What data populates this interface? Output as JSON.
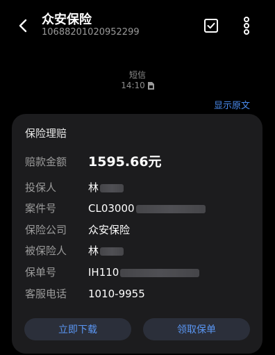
{
  "header": {
    "title": "众安保险",
    "number": "10688201020952299"
  },
  "message": {
    "type": "短信",
    "time": "14:10",
    "show_original": "显示原文"
  },
  "card": {
    "title": "保险理赔",
    "rows": [
      {
        "label": "赔款金额",
        "value": "1595.66元"
      },
      {
        "label": "投保人",
        "value": "林"
      },
      {
        "label": "案件号",
        "value": "CL03000"
      },
      {
        "label": "保险公司",
        "value": "众安保险"
      },
      {
        "label": "被保险人",
        "value": "林"
      },
      {
        "label": "保单号",
        "value": "IH110"
      },
      {
        "label": "客服电话",
        "value": "1010-9955"
      }
    ],
    "buttons": {
      "download": "立即下载",
      "policy": "领取保单"
    }
  },
  "colors": {
    "accent": "#4a8cf0",
    "card_bg": "#1c1c1e",
    "button_bg": "#2b2f3a"
  }
}
